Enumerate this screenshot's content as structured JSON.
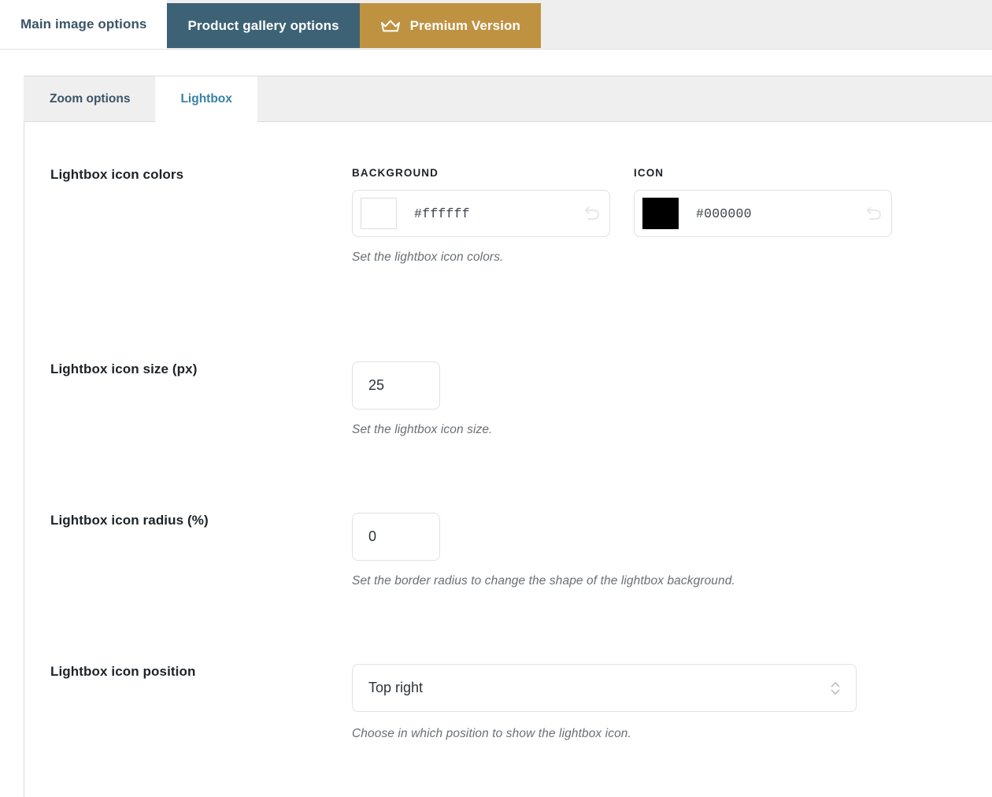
{
  "main_tabs": [
    {
      "label": "Main image options",
      "state": "active",
      "icon": null
    },
    {
      "label": "Product gallery options",
      "state": "selected",
      "icon": null
    },
    {
      "label": "Premium Version",
      "state": "premium",
      "icon": "crown-icon"
    }
  ],
  "sub_tabs": [
    {
      "label": "Zoom options",
      "state": "inactive"
    },
    {
      "label": "Lightbox",
      "state": "active"
    }
  ],
  "settings": {
    "colors": {
      "label": "Lightbox icon colors",
      "background": {
        "heading": "BACKGROUND",
        "value": "#ffffff",
        "swatch": "#ffffff",
        "reset_icon": "undo-icon"
      },
      "icon": {
        "heading": "ICON",
        "value": "#000000",
        "swatch": "#000000",
        "reset_icon": "undo-icon"
      },
      "description": "Set the lightbox icon colors."
    },
    "size": {
      "label": "Lightbox icon size (px)",
      "value": "25",
      "description": "Set the lightbox icon size."
    },
    "radius": {
      "label": "Lightbox icon radius (%)",
      "value": "0",
      "description": "Set the border radius to change the shape of the lightbox background."
    },
    "position": {
      "label": "Lightbox icon position",
      "value": "Top right",
      "description": "Choose in which position to show the lightbox icon.",
      "options": [
        "Top right"
      ]
    }
  },
  "colors": {
    "accent_dark": "#3d6275",
    "accent_gold": "#bf9242",
    "active_link": "#3783a3",
    "tabstrip_bg": "#eeeeee"
  }
}
